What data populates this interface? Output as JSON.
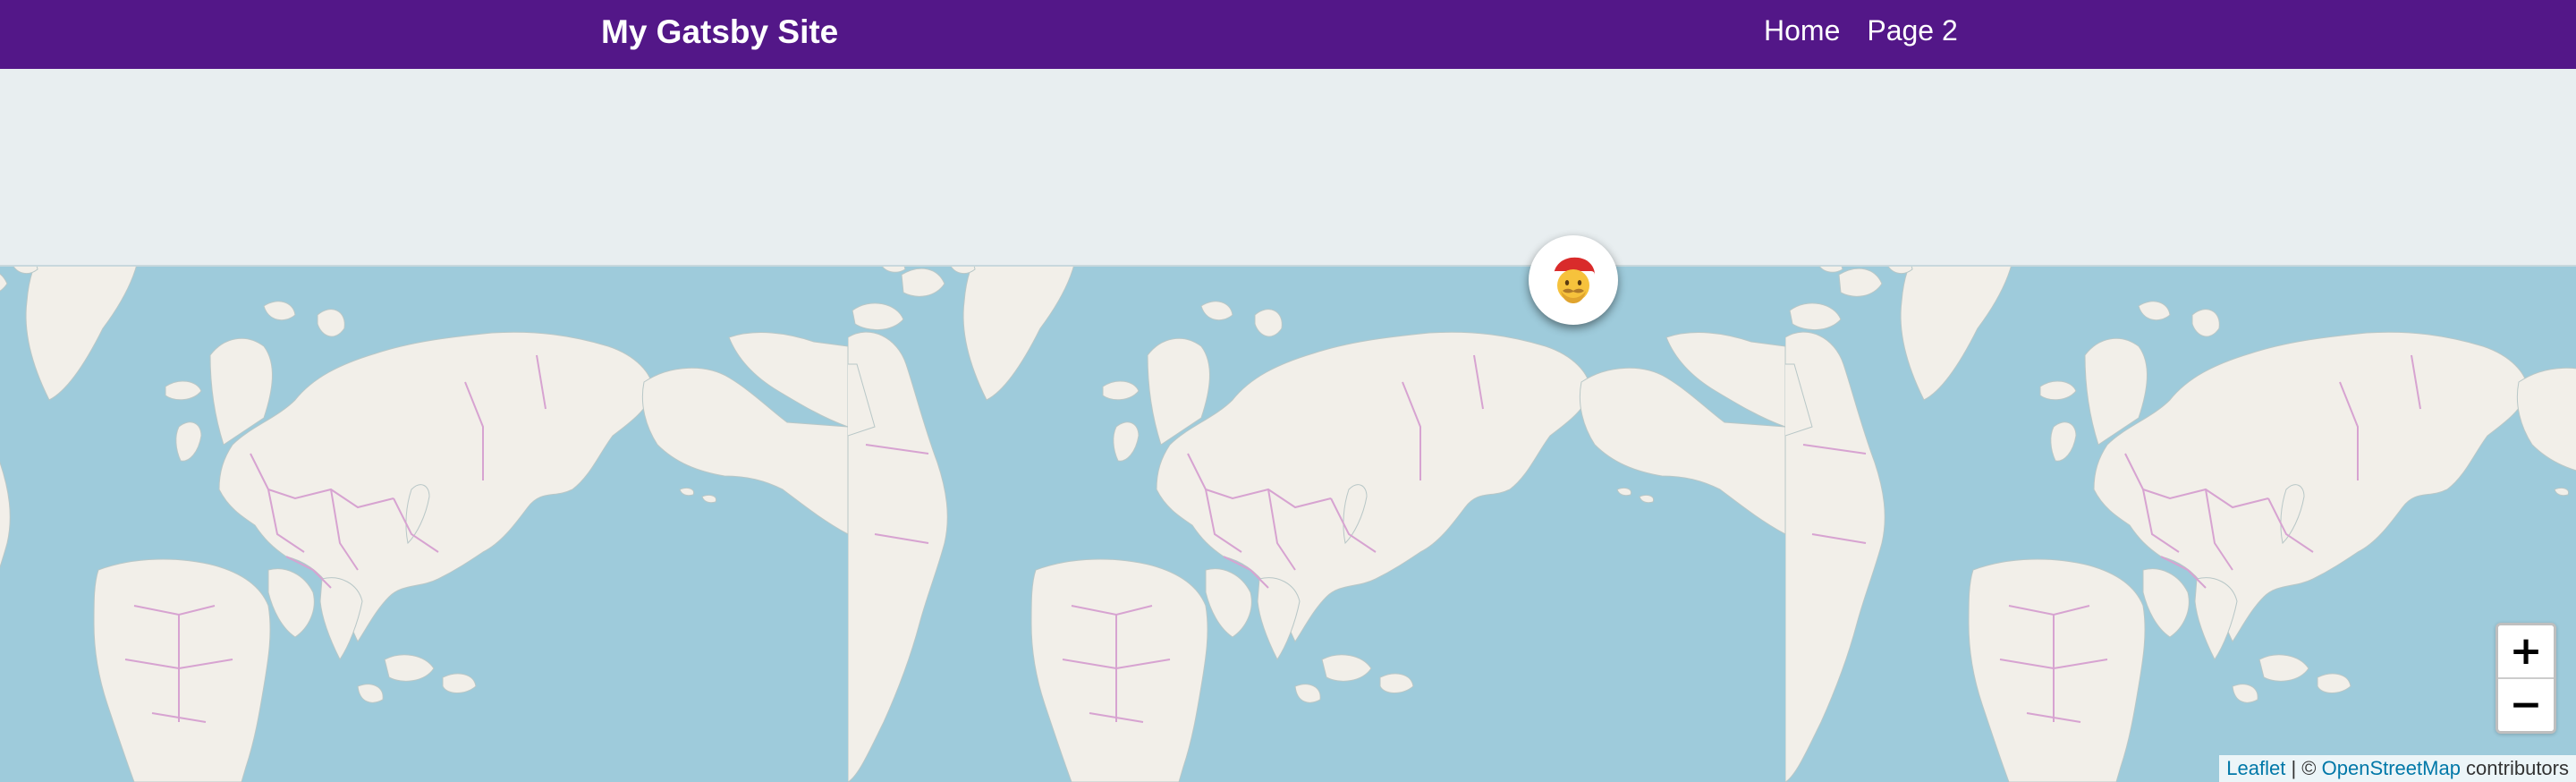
{
  "header": {
    "site_title": "My Gatsby Site",
    "nav": [
      {
        "label": "Home"
      },
      {
        "label": "Page 2"
      }
    ],
    "background_color": "#531788"
  },
  "map": {
    "ocean_color": "#9ecbdb",
    "land_color": "#f2efe9",
    "border_color": "#d7a3d1",
    "empty_tile_color": "#e8eef0",
    "marker": {
      "icon": "santa-claus-emoji",
      "glyph": "🎅"
    },
    "zoom": {
      "in_label": "+",
      "out_label": "−"
    },
    "attribution": {
      "leaflet": "Leaflet",
      "separator": " | © ",
      "osm": "OpenStreetMap",
      "suffix": " contributors"
    }
  }
}
